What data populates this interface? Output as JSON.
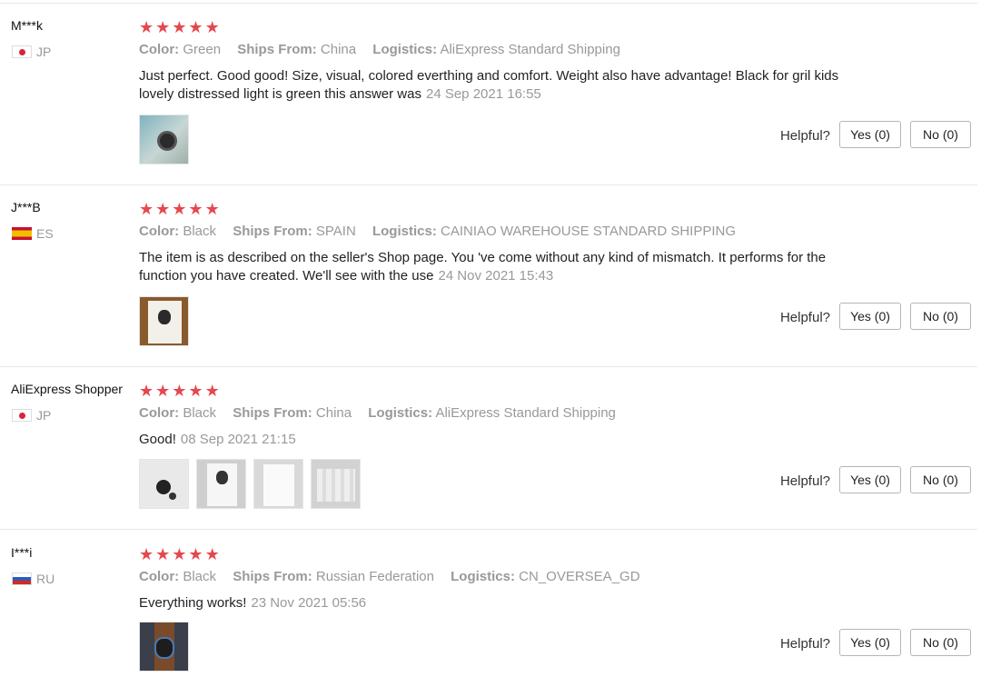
{
  "labels": {
    "color": "Color:",
    "ships_from": "Ships From:",
    "logistics": "Logistics:",
    "helpful": "Helpful?",
    "yes": "Yes (0)",
    "no": "No (0)"
  },
  "star_rating_max": 5,
  "reviews": [
    {
      "user": "M***k",
      "country": "JP",
      "rating": 5,
      "color": "Green",
      "ships_from": "China",
      "logistics": "AliExpress Standard Shipping",
      "text": "Just perfect. Good good! Size, visual, colored everthing and comfort. Weight also have advantage! Black for gril kids lovely distressed light is green this answer was",
      "date": "24 Sep 2021 16:55"
    },
    {
      "user": "J***B",
      "country": "ES",
      "rating": 5,
      "color": "Black",
      "ships_from": "SPAIN",
      "logistics": "CAINIAO WAREHOUSE STANDARD SHIPPING",
      "text": "The item is as described on the seller's Shop page. You 've come without any kind of mismatch. It performs for the function you have created. We'll see with the use",
      "date": "24 Nov 2021 15:43"
    },
    {
      "user": "AliExpress Shopper",
      "country": "JP",
      "rating": 5,
      "color": "Black",
      "ships_from": "China",
      "logistics": "AliExpress Standard Shipping",
      "text": "Good!",
      "date": "08 Sep 2021 21:15"
    },
    {
      "user": "I***i",
      "country": "RU",
      "rating": 5,
      "color": "Black",
      "ships_from": "Russian Federation",
      "logistics": "CN_OVERSEA_GD",
      "text": "Everything works!",
      "date": "23 Nov 2021 05:56"
    }
  ],
  "colors": {
    "star": "#e5484d",
    "meta_text": "#999999",
    "separator": "#e8e8e8"
  }
}
